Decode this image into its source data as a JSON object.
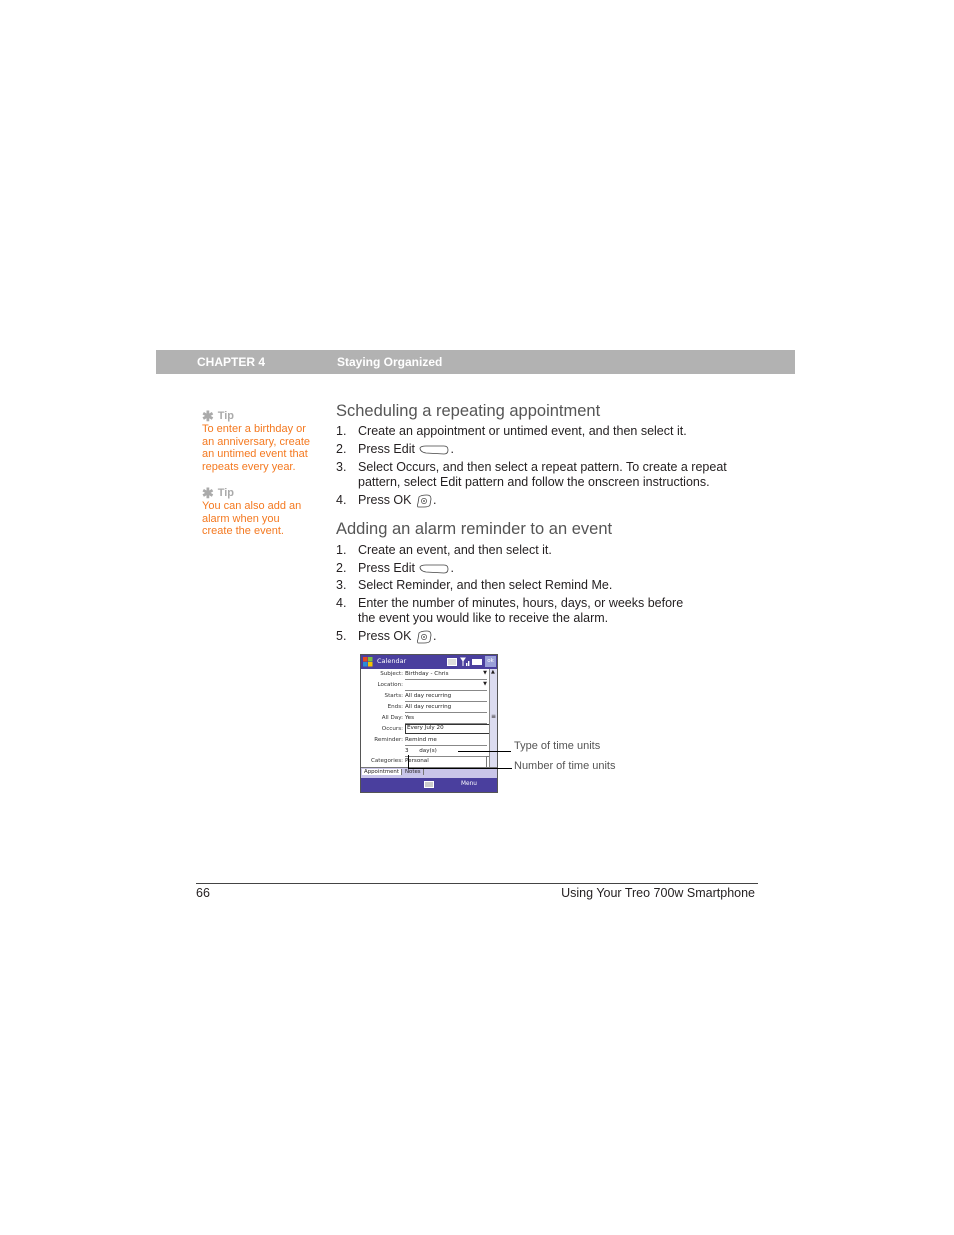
{
  "header": {
    "chapter_label": "CHAPTER 4",
    "chapter_title": "Staying Organized"
  },
  "tips": [
    {
      "heading": "Tip",
      "icon": "asterisk-icon",
      "lines": [
        "To enter a birthday or",
        "an anniversary, create",
        "an untimed event that",
        "repeats every year."
      ]
    },
    {
      "heading": "Tip",
      "icon": "asterisk-icon",
      "lines": [
        "You can also add an",
        "alarm when you",
        "create the event."
      ]
    }
  ],
  "sections": [
    {
      "heading": "Scheduling a repeating appointment",
      "steps": [
        {
          "num": "1.",
          "text": "Create an appointment or untimed event, and then select it."
        },
        {
          "num": "2.",
          "text": "Press Edit",
          "icon": "edit-key-icon",
          "suffix": "."
        },
        {
          "num": "3.",
          "text": "Select Occurs, and then select a repeat pattern. To create a repeat",
          "text2": "pattern, select Edit pattern and follow the onscreen instructions."
        },
        {
          "num": "4.",
          "text": "Press OK",
          "icon": "ok-key-icon",
          "suffix": "."
        }
      ]
    },
    {
      "heading": "Adding an alarm reminder to an event",
      "steps": [
        {
          "num": "1.",
          "text": "Create an event, and then select it."
        },
        {
          "num": "2.",
          "text": "Press Edit",
          "icon": "edit-key-icon",
          "suffix": "."
        },
        {
          "num": "3.",
          "text": "Select Reminder, and then select Remind Me."
        },
        {
          "num": "4.",
          "text": "Enter the number of minutes, hours, days, or weeks before",
          "text2": "the event you would like to receive the alarm."
        },
        {
          "num": "5.",
          "text": "Press OK",
          "icon": "ok-key-icon",
          "suffix": "."
        }
      ]
    }
  ],
  "device": {
    "app_title": "Calendar",
    "ok_label": "ok",
    "fields": [
      {
        "label": "Subject:",
        "value": "Birthday - Chris",
        "dropdown": true
      },
      {
        "label": "Location:",
        "value": "",
        "dropdown": true
      },
      {
        "label": "Starts:",
        "value": "All day recurring"
      },
      {
        "label": "Ends:",
        "value": "All day recurring"
      },
      {
        "label": "All Day:",
        "value": "Yes"
      },
      {
        "label": "Occurs:",
        "value": "Every July 20",
        "boxed": true
      },
      {
        "label": "Reminder:",
        "value": "Remind me"
      },
      {
        "label": "",
        "value": "3      day(s)"
      },
      {
        "label": "Categories:",
        "value": "Personal",
        "dropdown": true
      }
    ],
    "tabs": [
      "Appointment",
      "Notes"
    ],
    "menu_label": "Menu",
    "keyboard_icon": "keyboard-icon"
  },
  "callouts": [
    "Type of time units",
    "Number of time units"
  ],
  "footer": {
    "page_number": "66",
    "book_title": "Using Your Treo 700w Smartphone"
  }
}
